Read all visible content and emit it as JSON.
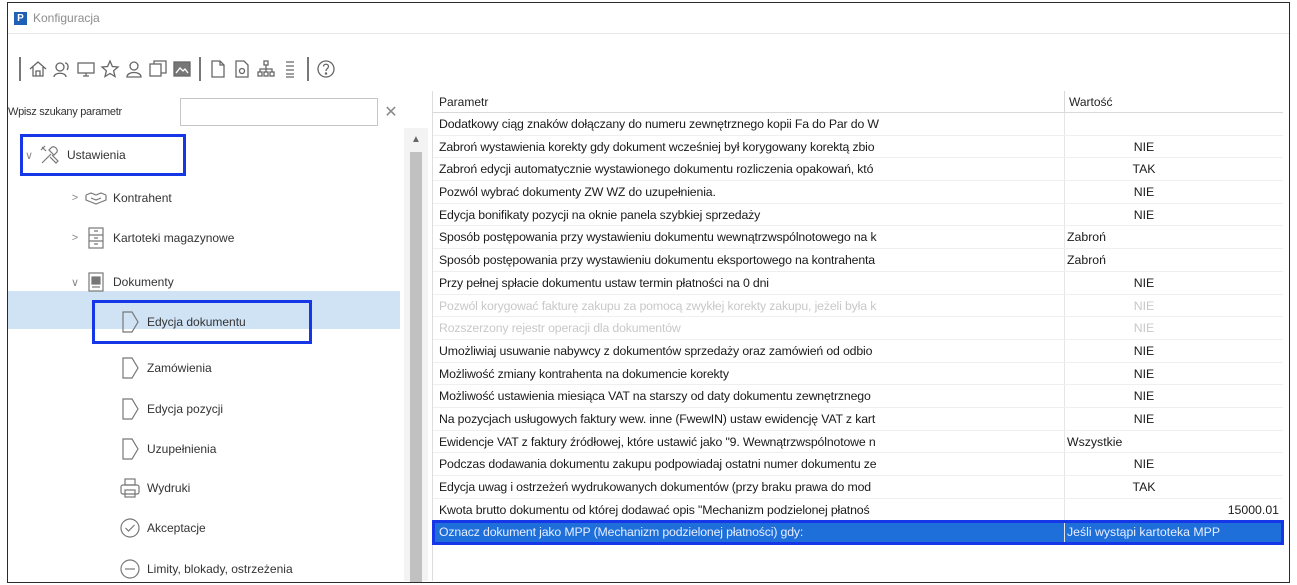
{
  "window": {
    "app_icon": "P",
    "title": "Konfiguracja"
  },
  "toolbar": {
    "icons": [
      "home-icon",
      "contacts-icon",
      "monitor-icon",
      "star-icon",
      "user-icon",
      "copy-icon",
      "image-icon",
      "document-icon",
      "document-preview-icon",
      "sitemap-icon",
      "list-icon",
      "help-icon"
    ]
  },
  "search": {
    "label": "Wpisz szukany parametr",
    "value": "",
    "clear": "✕"
  },
  "tree": {
    "items": [
      {
        "label": "Ustawienia",
        "icon": "tools-icon",
        "chevron": "∨"
      },
      {
        "label": "Kontrahent",
        "icon": "handshake-icon",
        "chevron": ">"
      },
      {
        "label": "Kartoteki magazynowe",
        "icon": "cabinet-icon",
        "chevron": ">"
      },
      {
        "label": "Dokumenty",
        "icon": "document-stack-icon",
        "chevron": "∨"
      },
      {
        "label": "Edycja dokumentu",
        "icon": "arrow-doc-icon"
      },
      {
        "label": "Zamówienia",
        "icon": "arrow-doc-icon"
      },
      {
        "label": "Edycja pozycji",
        "icon": "arrow-doc-icon"
      },
      {
        "label": "Uzupełnienia",
        "icon": "arrow-doc-icon"
      },
      {
        "label": "Wydruki",
        "icon": "printer-icon"
      },
      {
        "label": "Akceptacje",
        "icon": "check-circle-icon"
      },
      {
        "label": "Limity, blokady, ostrzeżenia",
        "icon": "minus-circle-icon"
      }
    ]
  },
  "grid": {
    "headers": {
      "param": "Parametr",
      "value": "Wartość"
    },
    "rows": [
      {
        "param": "Dodatkowy ciąg znaków dołączany do numeru zewnętrznego kopii Fa do Par do W",
        "value": "",
        "align": "center"
      },
      {
        "param": "Zabroń wystawienia korekty gdy dokument wcześniej był korygowany korektą zbio",
        "value": "NIE",
        "align": "center"
      },
      {
        "param": "Zabroń edycji automatycznie wystawionego dokumentu rozliczenia opakowań, któ",
        "value": "TAK",
        "align": "center"
      },
      {
        "param": "Pozwól wybrać dokumenty ZW WZ do uzupełnienia.",
        "value": "NIE",
        "align": "center"
      },
      {
        "param": "Edycja bonifikaty pozycji na oknie panela szybkiej sprzedaży",
        "value": "NIE",
        "align": "center"
      },
      {
        "param": "Sposób postępowania przy wystawieniu dokumentu wewnątrzwspólnotowego na k",
        "value": "Zabroń",
        "align": "left"
      },
      {
        "param": "Sposób postępowania przy wystawieniu dokumentu eksportowego na kontrahenta",
        "value": "Zabroń",
        "align": "left"
      },
      {
        "param": "Przy pełnej spłacie dokumentu ustaw termin płatności na 0 dni",
        "value": "NIE",
        "align": "center"
      },
      {
        "param": "Pozwól korygować fakturę zakupu za pomocą zwykłej korekty zakupu, jeżeli była k",
        "value": "NIE",
        "align": "center",
        "disabled": true
      },
      {
        "param": "Rozszerzony rejestr operacji dla dokumentów",
        "value": "NIE",
        "align": "center",
        "disabled": true
      },
      {
        "param": "Umożliwiaj usuwanie nabywcy z dokumentów sprzedaży oraz zamówień od odbio",
        "value": "NIE",
        "align": "center"
      },
      {
        "param": "Możliwość zmiany kontrahenta na dokumencie korekty",
        "value": "NIE",
        "align": "center"
      },
      {
        "param": "Możliwość ustawienia miesiąca VAT na starszy od daty dokumentu zewnętrznego",
        "value": "NIE",
        "align": "center"
      },
      {
        "param": "Na pozycjach usługowych faktury wew. inne (FwewIN) ustaw ewidencję VAT z kart",
        "value": "NIE",
        "align": "center"
      },
      {
        "param": "Ewidencje VAT z faktury źródłowej, które ustawić jako \"9. Wewnątrzwspólnotowe n",
        "value": "Wszystkie",
        "align": "left"
      },
      {
        "param": "Podczas dodawania dokumentu zakupu podpowiadaj ostatni numer dokumentu ze",
        "value": "NIE",
        "align": "center"
      },
      {
        "param": "Edycja uwag i ostrzeżeń wydrukowanych dokumentów (przy braku prawa do mod",
        "value": "TAK",
        "align": "center"
      },
      {
        "param": "Kwota brutto dokumentu od której dodawać opis \"Mechanizm podzielonej płatnoś",
        "value": "15000.01",
        "align": "right"
      },
      {
        "param": "Oznacz dokument jako MPP (Mechanizm podzielonej płatności) gdy:",
        "value": "Jeśli wystąpi kartoteka MPP",
        "align": "left",
        "selected": true
      }
    ]
  }
}
